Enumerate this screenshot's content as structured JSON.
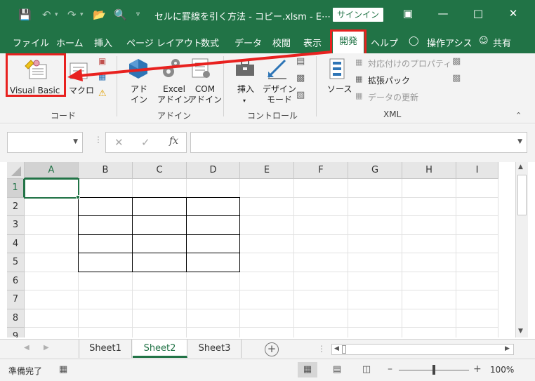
{
  "title_bar": {
    "document_title": "セルに罫線を引く方法 - コピー.xlsm  -  E⋯",
    "signin_label": "サインイン",
    "colors": {
      "excel_green": "#217346",
      "highlight_red": "#e8211f"
    }
  },
  "menu": {
    "tabs": [
      "ファイル",
      "ホーム",
      "挿入",
      "ページ レイアウト",
      "数式",
      "データ",
      "校閲",
      "表示",
      "開発",
      "ヘルプ",
      "操作アシス",
      "共有"
    ],
    "active_tab": "開発"
  },
  "ribbon": {
    "groups": [
      {
        "label": "コード",
        "buttons": [
          {
            "label": "Visual Basic",
            "icon": "visual-basic-icon"
          },
          {
            "label": "マクロ",
            "icon": "macro-icon"
          }
        ]
      },
      {
        "label": "アドイン",
        "buttons": [
          {
            "label": "アド\nイン",
            "icon": "addin-icon"
          },
          {
            "label": "Excel\nアドイン",
            "icon": "excel-addin-gear-icon"
          },
          {
            "label": "COM\nアドイン",
            "icon": "com-addin-icon"
          }
        ]
      },
      {
        "label": "コントロール",
        "buttons": [
          {
            "label": "挿入",
            "icon": "insert-control-icon"
          },
          {
            "label": "デザイン\nモード",
            "icon": "design-mode-icon"
          }
        ]
      },
      {
        "label": "XML",
        "buttons": [
          {
            "label": "ソース",
            "icon": "xml-source-icon"
          }
        ],
        "small_items": [
          "対応付けのプロパティ",
          "拡張パック",
          "データの更新"
        ]
      }
    ]
  },
  "formula_bar": {
    "namebox_value": "",
    "formula_value": "",
    "fx_label": "fx"
  },
  "sheet": {
    "columns": [
      "A",
      "B",
      "C",
      "D",
      "E",
      "F",
      "G",
      "H",
      "I"
    ],
    "rows": [
      "1",
      "2",
      "3",
      "4",
      "5",
      "6",
      "7",
      "8",
      "9"
    ],
    "active_cell": "A1",
    "bordered_range": "B2:D5"
  },
  "sheet_tabs": {
    "tabs": [
      "Sheet1",
      "Sheet2",
      "Sheet3"
    ],
    "active": "Sheet2"
  },
  "status_bar": {
    "status": "準備完了",
    "zoom": "100%"
  }
}
